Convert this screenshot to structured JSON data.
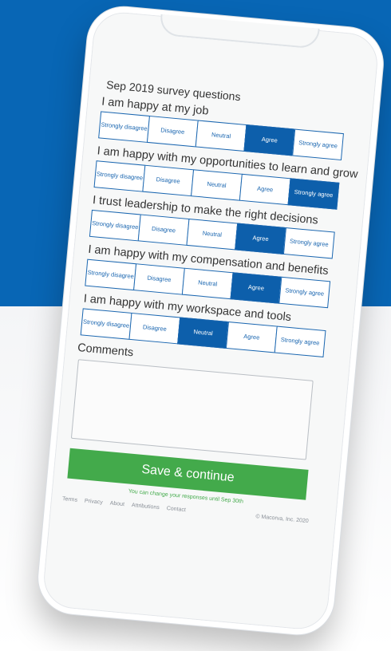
{
  "survey": {
    "title": "Sep 2019 survey questions",
    "options": [
      "Strongly disagree",
      "Disagree",
      "Neutral",
      "Agree",
      "Strongly agree"
    ],
    "questions": [
      {
        "label": "I am happy at my job",
        "selected": "Agree"
      },
      {
        "label": "I am happy with my opportunities to learn and grow",
        "selected": "Strongly agree"
      },
      {
        "label": "I trust leadership to make the right decisions",
        "selected": "Agree"
      },
      {
        "label": "I am happy with my compensation and benefits",
        "selected": "Agree"
      },
      {
        "label": "I am happy with my workspace and tools",
        "selected": "Neutral"
      }
    ],
    "comments_label": "Comments",
    "comments_value": "",
    "save_label": "Save & continue",
    "change_note": "You can change your responses until Sep 30th"
  },
  "footer": {
    "links": [
      "Terms",
      "Privacy",
      "About",
      "Attributions",
      "Contact"
    ],
    "copyright": "© Macorva, Inc. 2020"
  },
  "colors": {
    "brand_blue": "#0866b5",
    "selected": "#0d5fab",
    "save_green": "#43aa4b"
  }
}
